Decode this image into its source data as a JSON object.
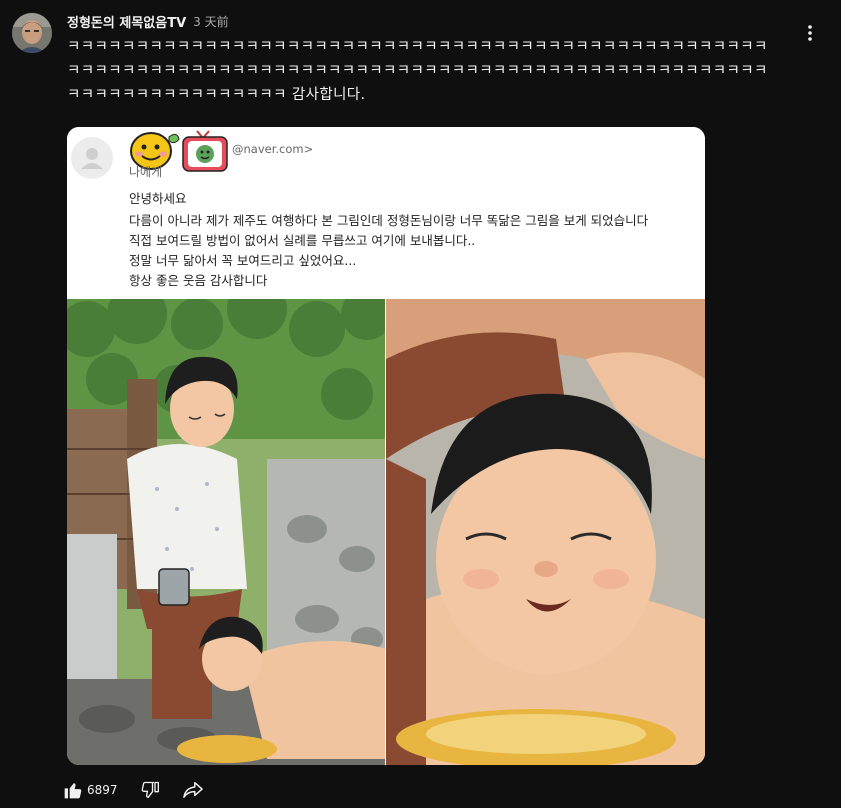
{
  "post": {
    "channel_name": "정형돈의 제목없음TV",
    "time": "3 天前",
    "text": "ㅋㅋㅋㅋㅋㅋㅋㅋㅋㅋㅋㅋㅋㅋㅋㅋㅋㅋㅋㅋㅋㅋㅋㅋㅋㅋㅋㅋㅋㅋㅋㅋㅋㅋㅋㅋㅋㅋㅋㅋㅋㅋㅋㅋㅋㅋㅋㅋㅋㅋㅋㅋㅋㅋㅋㅋㅋㅋㅋㅋㅋㅋㅋㅋㅋㅋㅋㅋㅋㅋㅋㅋㅋㅋㅋㅋㅋㅋㅋㅋㅋㅋㅋㅋㅋㅋㅋㅋㅋㅋㅋㅋㅋㅋㅋㅋㅋㅋㅋㅋㅋㅋㅋㅋㅋㅋㅋㅋㅋㅋㅋㅋㅋㅋㅋㅋㅋㅋ 감사합니다."
  },
  "email": {
    "sender_email": "@naver.com>",
    "recipient": "나에게",
    "lines": [
      "안녕하세요",
      "다름이 아니라 제가 제주도 여행하다 본 그림인데 정형돈님이랑 너무 똑닮은 그림을 보게 되었습니다",
      "직접 보여드릴 방법이 없어서 실례를 무릅쓰고 여기에 보내봅니다..",
      "정말 너무 닮아서 꼭 보여드리고 싶었어요...",
      "항상 좋은 웃음 감사합니다"
    ]
  },
  "actions": {
    "like_count": "6897"
  },
  "icons": {
    "menu": "more-vertical-icon",
    "like": "thumbs-up-icon",
    "dislike": "thumbs-down-icon",
    "share": "share-arrow-icon"
  },
  "colors": {
    "background": "#0f0f0f",
    "text": "#f1f1f1",
    "secondary_text": "#aaaaaa"
  }
}
